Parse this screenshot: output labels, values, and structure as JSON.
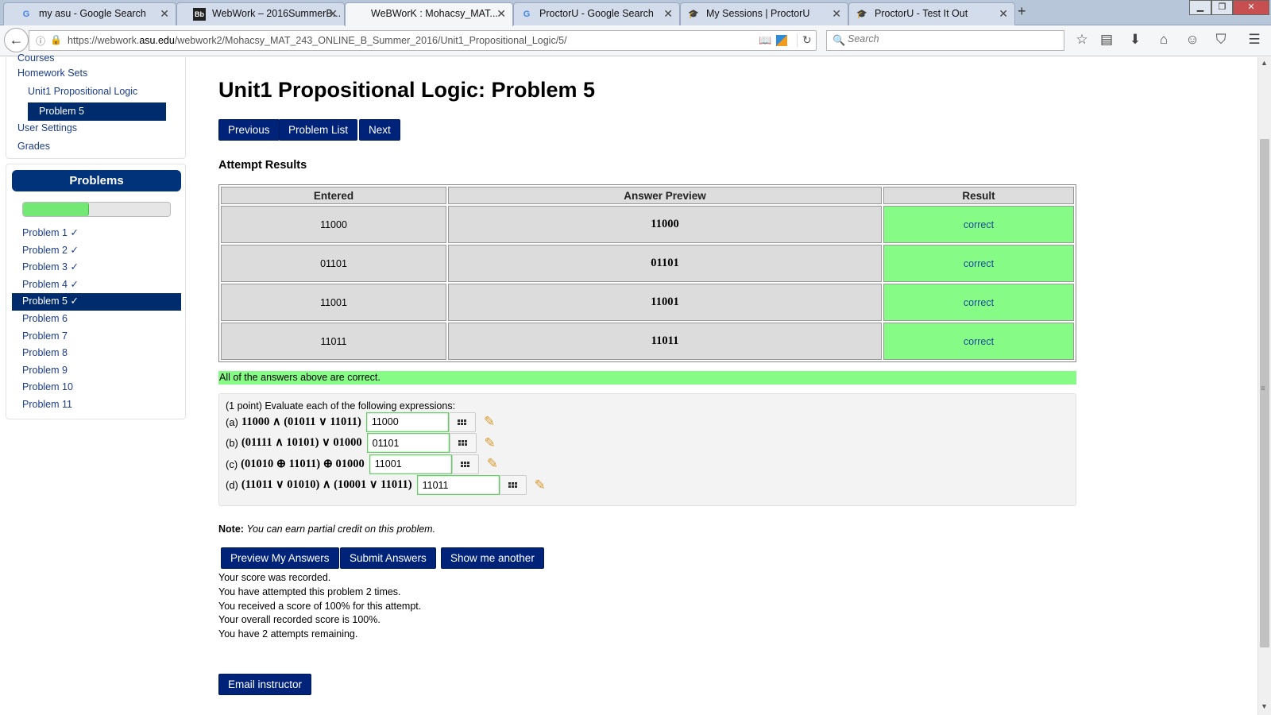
{
  "browser": {
    "tabs": [
      {
        "title": "my asu - Google Search",
        "icon": "G"
      },
      {
        "title": "WebWork – 2016SummerB...",
        "icon": "Bb"
      },
      {
        "title": "WeBWorK : Mohacsy_MAT...",
        "icon": ""
      },
      {
        "title": "ProctorU - Google Search",
        "icon": "G"
      },
      {
        "title": "My Sessions | ProctorU",
        "icon": "🎓"
      },
      {
        "title": "ProctorU - Test It Out",
        "icon": "🎓"
      }
    ],
    "new_tab": "+",
    "url_prefix": "https://webwork.",
    "url_domain": "asu.edu",
    "url_path": "/webwork2/Mohacsy_MAT_243_ONLINE_B_Summer_2016/Unit1_Propositional_Logic/5/",
    "search_placeholder": "Search"
  },
  "sidebar": {
    "courses": "Courses",
    "homework_sets": "Homework Sets",
    "set_name": "Unit1 Propositional Logic",
    "current_problem": "Problem 5",
    "user_settings": "User Settings",
    "grades": "Grades"
  },
  "problems_panel": {
    "heading": "Problems",
    "progress_fraction": 0.45,
    "items": [
      "Problem 1 ✓",
      "Problem 2 ✓",
      "Problem 3 ✓",
      "Problem 4 ✓",
      "Problem 5 ✓",
      "Problem 6",
      "Problem 7",
      "Problem 8",
      "Problem 9",
      "Problem 10",
      "Problem 11"
    ],
    "current_index": 4
  },
  "main": {
    "title": "Unit1 Propositional Logic: Problem 5",
    "nav_buttons": {
      "previous": "Previous",
      "problem_list": "Problem List",
      "next": "Next"
    },
    "attempt_heading": "Attempt Results",
    "results_headers": [
      "Entered",
      "Answer Preview",
      "Result"
    ],
    "results_rows": [
      {
        "entered": "11000",
        "preview": "11000",
        "result": "correct"
      },
      {
        "entered": "01101",
        "preview": "01101",
        "result": "correct"
      },
      {
        "entered": "11001",
        "preview": "11001",
        "result": "correct"
      },
      {
        "entered": "11011",
        "preview": "11011",
        "result": "correct"
      }
    ],
    "all_correct": "All of the answers above are correct.",
    "intro": "(1 point) Evaluate each of the following expressions:",
    "parts": [
      {
        "label": "(a)",
        "expr": "11000 ∧ (01011 ∨ 11011)",
        "value": "11000"
      },
      {
        "label": "(b)",
        "expr": "(01111 ∧ 10101) ∨ 01000",
        "value": "01101"
      },
      {
        "label": "(c)",
        "expr": "(01010 ⊕ 11011) ⊕ 01000",
        "value": "11001"
      },
      {
        "label": "(d)",
        "expr": "(11011 ∨ 01010) ∧ (10001 ∨ 11011)",
        "value": "11011"
      }
    ],
    "note_label": "Note:",
    "note_text": "You can earn partial credit on this problem.",
    "action_buttons": {
      "preview": "Preview My Answers",
      "submit": "Submit Answers",
      "another": "Show me another"
    },
    "score_lines": [
      "Your score was recorded.",
      "You have attempted this problem 2 times.",
      "You received a score of 100% for this attempt.",
      "Your overall recorded score is 100%.",
      "You have 2 attempts remaining."
    ],
    "email_button": "Email instructor"
  }
}
